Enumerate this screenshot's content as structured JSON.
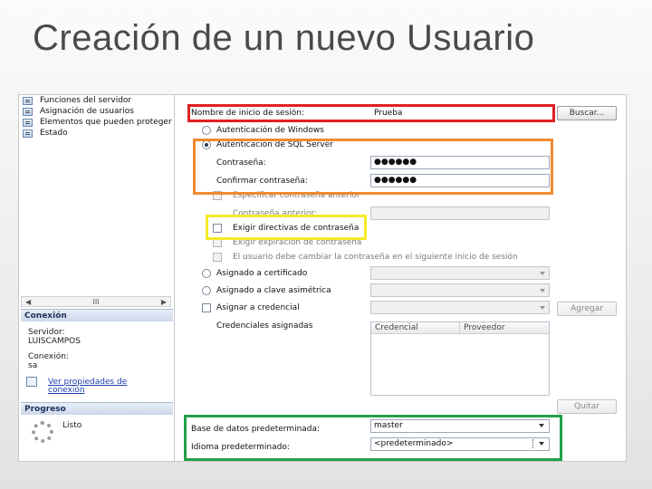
{
  "slide": {
    "title": "Creación de un nuevo Usuario"
  },
  "left_pane": {
    "tree_items": [
      {
        "label": "Funciones del servidor",
        "icon": "page-icon"
      },
      {
        "label": "Asignación de usuarios",
        "icon": "page-icon"
      },
      {
        "label": "Elementos que pueden proteger",
        "icon": "page-icon"
      },
      {
        "label": "Estado",
        "icon": "page-icon"
      }
    ],
    "scroll_marker": "III",
    "connection": {
      "header": "Conexión",
      "server_label": "Servidor:",
      "server_value": "LUISCAMPOS",
      "conn_label": "Conexión:",
      "conn_value": "sa",
      "view_props_link_line1": "Ver propiedades de",
      "view_props_link_line2": "conexión"
    },
    "progress": {
      "header": "Progreso",
      "status": "Listo"
    }
  },
  "form": {
    "login_label": "Nombre de inicio de sesión:",
    "login_value": "Prueba",
    "search_button": "Buscar...",
    "auth_windows": "Autenticación de Windows",
    "auth_sql": "Autenticación de SQL Server",
    "password_label": "Contraseña:",
    "password_value": "●●●●●●",
    "confirm_label": "Confirmar contraseña:",
    "confirm_value": "●●●●●●",
    "specify_old_password": "Especificar contraseña anterior",
    "old_password_label": "Contraseña anterior:",
    "enforce_policy": "Exigir directivas de contraseña",
    "enforce_expiration": "Exigir expiración de contraseña",
    "must_change": "El usuario debe cambiar la contraseña en el siguiente inicio de sesión",
    "mapped_certificate": "Asignado a certificado",
    "mapped_asym_key": "Asignado a clave asimétrica",
    "map_credential": "Asignar a credencial",
    "add_button": "Agregar",
    "mapped_credentials": "Credenciales asignadas",
    "grid_columns": [
      "Credencial",
      "Proveedor"
    ],
    "remove_button": "Quitar",
    "default_db_label": "Base de datos predeterminada:",
    "default_db_value": "master",
    "default_lang_label": "Idioma predeterminado:",
    "default_lang_value": "<predeterminado>"
  },
  "colors": {
    "highlight_login": "#e02020",
    "highlight_sql_auth": "#f08a30",
    "highlight_policy": "#f4ea28",
    "highlight_defaults": "#22a04a"
  }
}
